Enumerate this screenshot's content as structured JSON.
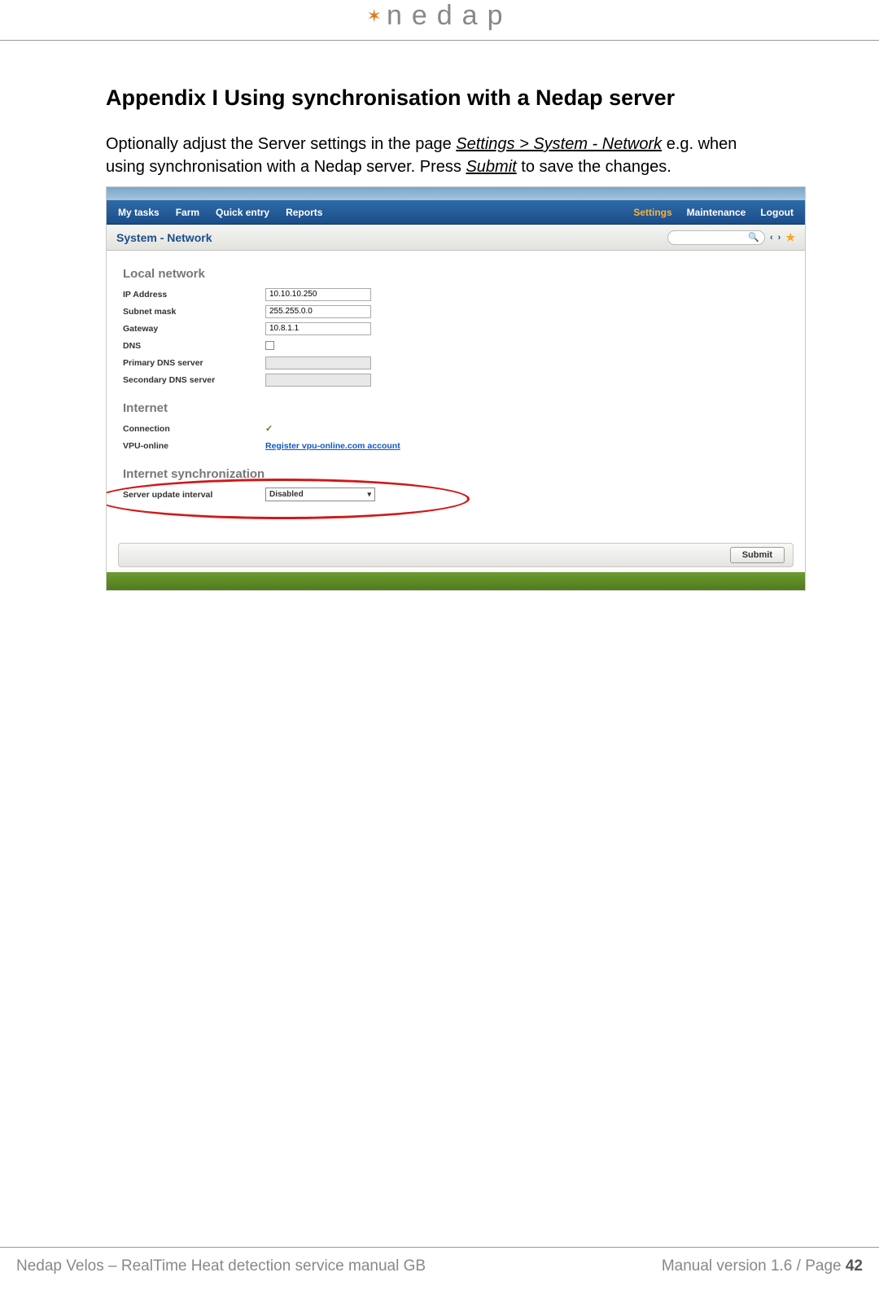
{
  "header": {
    "logo_text": "nedap"
  },
  "title": "Appendix I    Using synchronisation with a Nedap server",
  "intro": {
    "t1": "Optionally adjust the Server settings in the page ",
    "path": "Settings > System - Network",
    "t2": " e.g. when using synchronisation with a Nedap server. Press ",
    "action": "Submit",
    "t3": " to save the changes."
  },
  "app": {
    "nav_left": [
      "My tasks",
      "Farm",
      "Quick entry",
      "Reports"
    ],
    "nav_right": [
      "Settings",
      "Maintenance",
      "Logout"
    ],
    "nav_active": "Settings",
    "page_title": "System - Network",
    "sections": {
      "local": {
        "head": "Local network",
        "rows": [
          {
            "label": "IP Address",
            "value": "10.10.10.250",
            "type": "text"
          },
          {
            "label": "Subnet mask",
            "value": "255.255.0.0",
            "type": "text"
          },
          {
            "label": "Gateway",
            "value": "10.8.1.1",
            "type": "text"
          },
          {
            "label": "DNS",
            "value": "",
            "type": "checkbox"
          },
          {
            "label": "Primary DNS server",
            "value": "",
            "type": "text-disabled"
          },
          {
            "label": "Secondary DNS server",
            "value": "",
            "type": "text-disabled"
          }
        ]
      },
      "internet": {
        "head": "Internet",
        "rows": [
          {
            "label": "Connection",
            "value": "✓",
            "type": "check"
          },
          {
            "label": "VPU-online",
            "value": "Register vpu-online.com account",
            "type": "link"
          }
        ]
      },
      "sync": {
        "head": "Internet synchronization",
        "rows": [
          {
            "label": "Server update interval",
            "value": "Disabled",
            "type": "select"
          }
        ]
      }
    },
    "submit": "Submit"
  },
  "footer": {
    "left": "Nedap Velos – RealTime Heat detection service manual GB",
    "right_prefix": "Manual version 1.6 / Page ",
    "page": "42"
  }
}
